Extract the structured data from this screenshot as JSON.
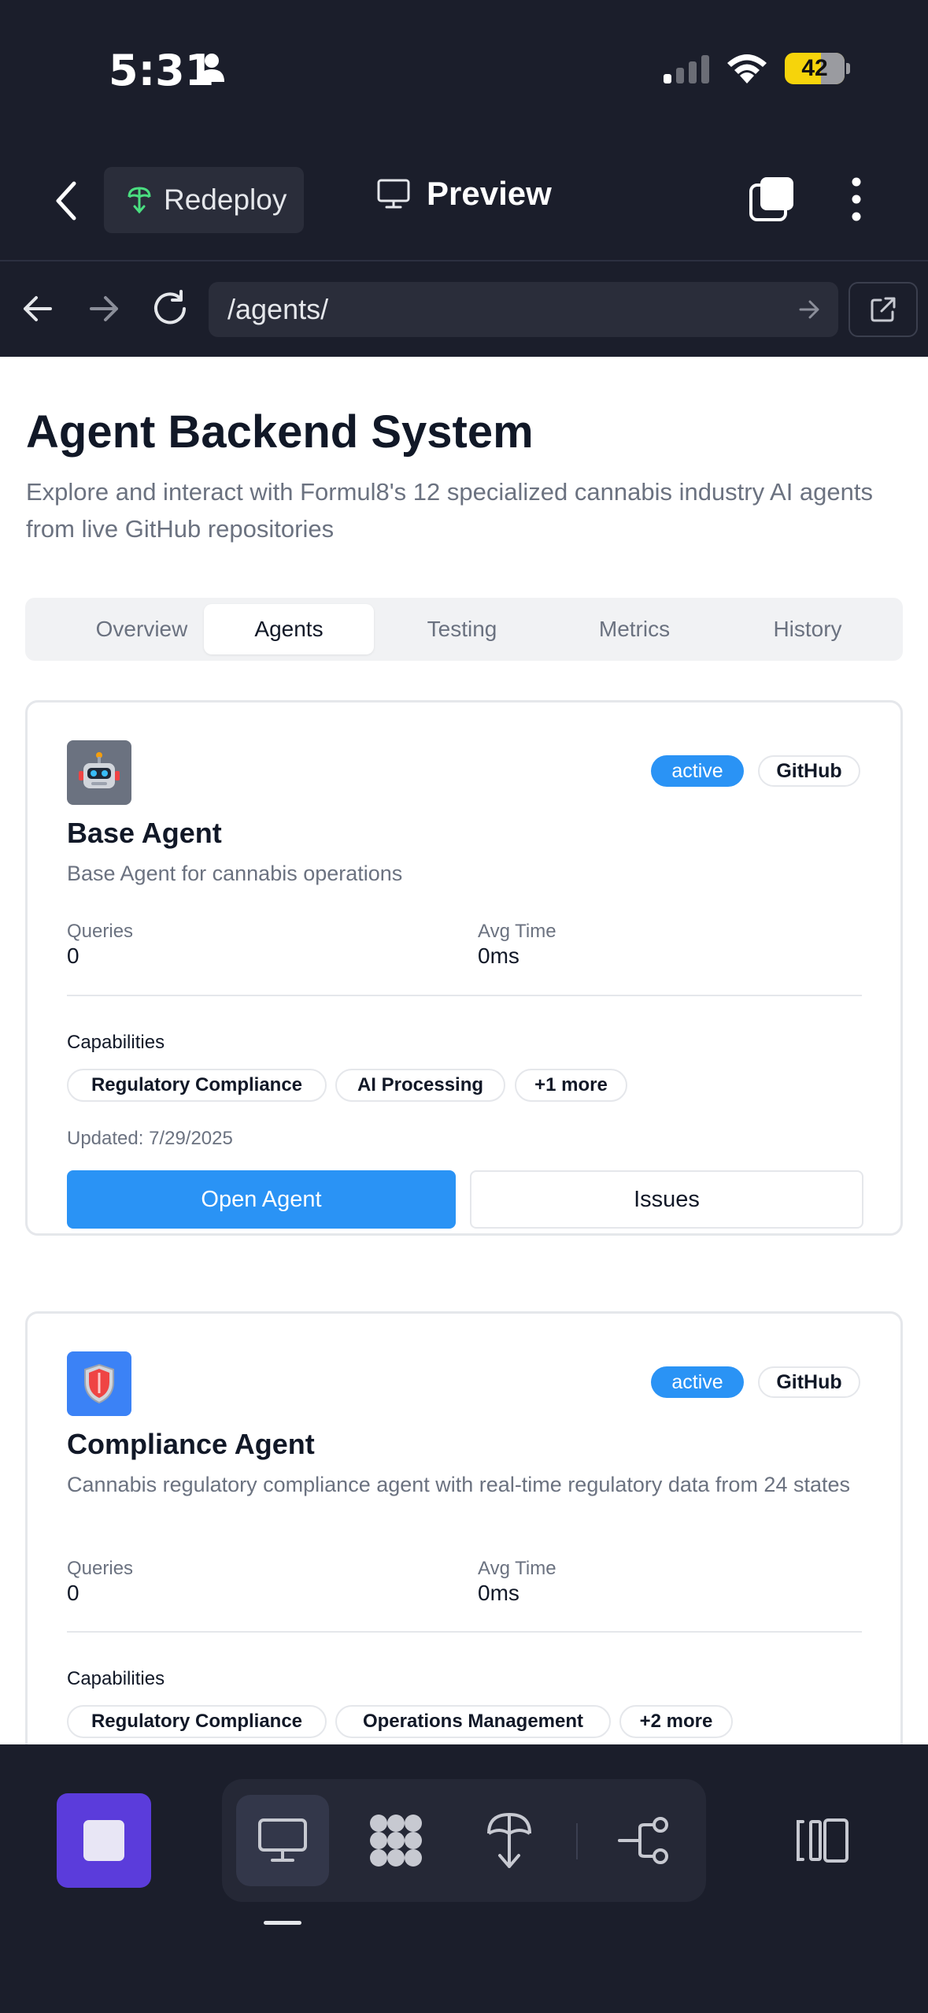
{
  "status_bar": {
    "time": "5:31",
    "battery": "42"
  },
  "app_header": {
    "redeploy_label": "Redeploy",
    "preview_label": "Preview"
  },
  "browser": {
    "url": "/agents/"
  },
  "page": {
    "title": "Agent Backend System",
    "subtitle": "Explore and interact with Formul8's 12 specialized cannabis industry AI agents from live GitHub repositories"
  },
  "tabs": [
    {
      "label": "Overview",
      "active": false
    },
    {
      "label": "Agents",
      "active": true
    },
    {
      "label": "Testing",
      "active": false
    },
    {
      "label": "Metrics",
      "active": false
    },
    {
      "label": "History",
      "active": false
    }
  ],
  "agents": [
    {
      "name": "Base Agent",
      "description": "Base Agent for cannabis operations",
      "status": "active",
      "source": "GitHub",
      "icon": "robot-icon",
      "queries_label": "Queries",
      "queries": "0",
      "avg_time_label": "Avg Time",
      "avg_time": "0ms",
      "capabilities_label": "Capabilities",
      "capabilities": [
        "Regulatory Compliance",
        "AI Processing",
        "+1 more"
      ],
      "updated": "Updated: 7/29/2025",
      "open_label": "Open Agent",
      "issues_label": "Issues"
    },
    {
      "name": "Compliance Agent",
      "description": "Cannabis regulatory compliance agent with real-time regulatory data from 24 states",
      "status": "active",
      "source": "GitHub",
      "icon": "shield-icon",
      "queries_label": "Queries",
      "queries": "0",
      "avg_time_label": "Avg Time",
      "avg_time": "0ms",
      "capabilities_label": "Capabilities",
      "capabilities": [
        "Regulatory Compliance",
        "Operations Management",
        "+2 more"
      ]
    }
  ],
  "colors": {
    "accent": "#2a93f5",
    "chrome_bg": "#1b1e2b",
    "stop_button": "#5b3cdb",
    "battery": "#f6d40b"
  }
}
